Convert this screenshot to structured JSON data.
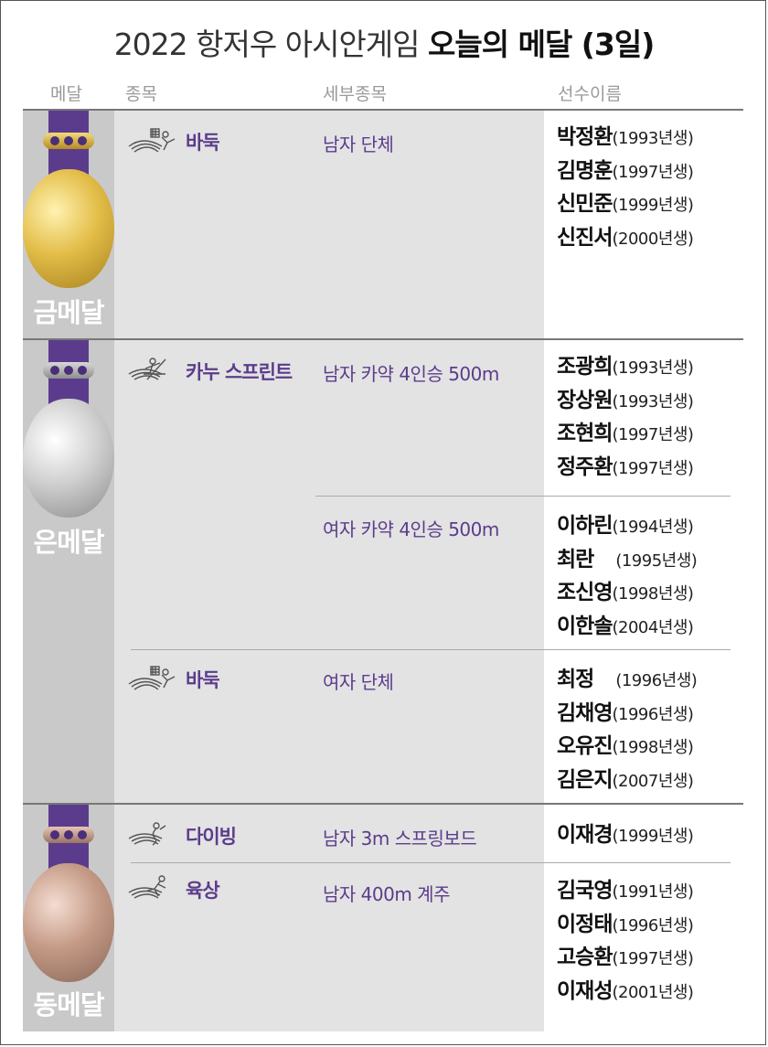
{
  "title": {
    "normal": "2022 항저우 아시안게임 ",
    "bold": "오늘의 메달 (3일)"
  },
  "headers": {
    "medal": "메달",
    "sport": "종목",
    "event": "세부종목",
    "athletes": "선수이름"
  },
  "gold": {
    "label": "금메달",
    "entries": [
      {
        "sport": "바둑",
        "icon": "go-icon",
        "event": "남자 단체",
        "athletes": [
          {
            "name": "박정환",
            "year": "(1993년생)"
          },
          {
            "name": "김명훈",
            "year": "(1997년생)"
          },
          {
            "name": "신민준",
            "year": "(1999년생)"
          },
          {
            "name": "신진서",
            "year": "(2000년생)"
          }
        ]
      }
    ]
  },
  "silver": {
    "label": "은메달",
    "entries": [
      {
        "sport": "카누 스프린트",
        "icon": "canoe-icon",
        "event": "남자 카약 4인승 500m",
        "athletes": [
          {
            "name": "조광희",
            "year": "(1993년생)"
          },
          {
            "name": "장상원",
            "year": "(1993년생)"
          },
          {
            "name": "조현희",
            "year": "(1997년생)"
          },
          {
            "name": "정주환",
            "year": "(1997년생)"
          }
        ]
      },
      {
        "sport": "",
        "icon": "",
        "event": "여자 카약 4인승 500m",
        "athletes": [
          {
            "name": "이하린",
            "year": "(1994년생)"
          },
          {
            "name": "최란",
            "year": "(1995년생)"
          },
          {
            "name": "조신영",
            "year": "(1998년생)"
          },
          {
            "name": "이한솔",
            "year": "(2004년생)"
          }
        ]
      },
      {
        "sport": "바둑",
        "icon": "go-icon",
        "event": "여자 단체",
        "athletes": [
          {
            "name": "최정",
            "year": "(1996년생)"
          },
          {
            "name": "김채영",
            "year": "(1996년생)"
          },
          {
            "name": "오유진",
            "year": "(1998년생)"
          },
          {
            "name": "김은지",
            "year": "(2007년생)"
          }
        ]
      }
    ]
  },
  "bronze": {
    "label": "동메달",
    "entries": [
      {
        "sport": "다이빙",
        "icon": "diving-icon",
        "event": "남자 3m 스프링보드",
        "athletes": [
          {
            "name": "이재경",
            "year": "(1999년생)"
          }
        ]
      },
      {
        "sport": "육상",
        "icon": "athletics-icon",
        "event": "남자 400m 계주",
        "athletes": [
          {
            "name": "김국영",
            "year": "(1991년생)"
          },
          {
            "name": "이정태",
            "year": "(1996년생)"
          },
          {
            "name": "고승환",
            "year": "(1997년생)"
          },
          {
            "name": "이재성",
            "year": "(2001년생)"
          }
        ]
      }
    ]
  },
  "colors": {
    "accent": "#5b3c8c",
    "section_bg": "#e3e3e3",
    "medal_col_bg": "#c9c9c9"
  }
}
